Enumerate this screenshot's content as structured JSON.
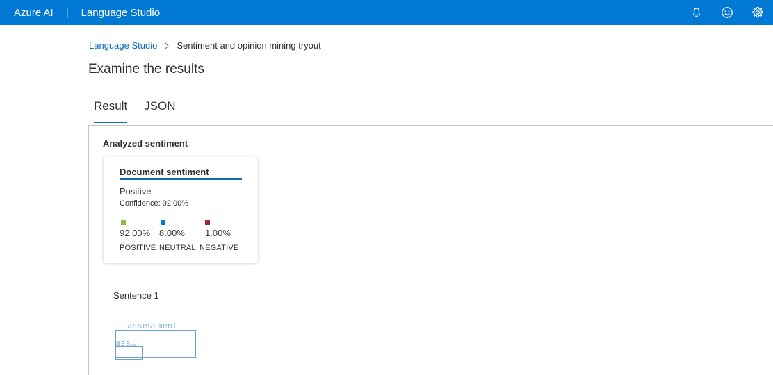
{
  "header": {
    "brand": "Azure AI",
    "separator": "|",
    "product": "Language Studio",
    "icons": [
      "bell-icon",
      "smiley-icon",
      "gear-icon"
    ]
  },
  "breadcrumb": {
    "root": "Language Studio",
    "current": "Sentiment and opinion mining tryout"
  },
  "page_title": "Examine the results",
  "tabs": [
    {
      "label": "Result",
      "active": true
    },
    {
      "label": "JSON",
      "active": false
    }
  ],
  "results": {
    "section_label": "Analyzed sentiment",
    "document_card": {
      "title": "Document sentiment",
      "sentiment": "Positive",
      "confidence": "Confidence: 92.00%",
      "scores": [
        {
          "value": "92.00%",
          "label": "POSITIVE",
          "color": "#8cbd3f"
        },
        {
          "value": "8.00%",
          "label": "NEUTRAL",
          "color": "#0078d4"
        },
        {
          "value": "1.00%",
          "label": "NEGATIVE",
          "color": "#a4262c"
        }
      ]
    },
    "sentence_label": "Sentence 1",
    "assessment_label": "assessment",
    "assessment_truncated": "ass…"
  },
  "colors": {
    "header_bg": "#0078d4",
    "accent": "#0f6cbd"
  }
}
